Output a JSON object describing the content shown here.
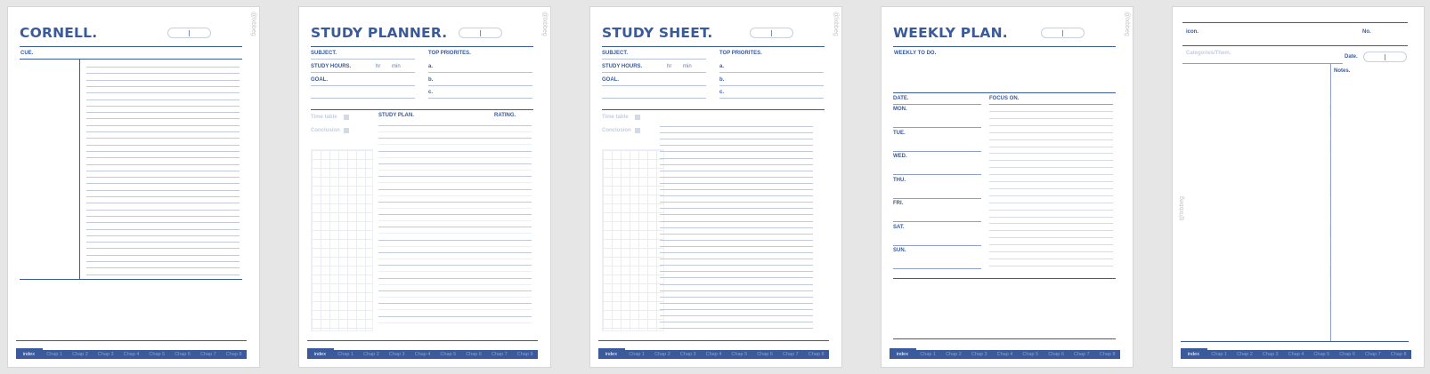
{
  "brand": "@lxbbeg",
  "tabs": [
    "index",
    "Chap 1",
    "Chap 2",
    "Chap 3",
    "Chap 4",
    "Chap 5",
    "Chap 6",
    "Chap 7",
    "Chap 8"
  ],
  "cornell": {
    "title": "CORNELL.",
    "cue_label": "CUE."
  },
  "planner": {
    "title": "STUDY PLANNER.",
    "subject": "SUBJECT.",
    "study_hours": "STUDY HOURS.",
    "hr": "hr",
    "min": "min",
    "goal": "GOAL.",
    "top_priorities": "TOP PRIORITES.",
    "prio_a": "a.",
    "prio_b": "b.",
    "prio_c": "c.",
    "time_table": "Time table",
    "conclusion": "Conclusion",
    "study_plan": "STUDY PLAN.",
    "rating": "RATING."
  },
  "sheet": {
    "title": "STUDY SHEET.",
    "subject": "SUBJECT.",
    "study_hours": "STUDY HOURS.",
    "hr": "hr",
    "min": "min",
    "goal": "GOAL.",
    "top_priorities": "TOP PRIORITES.",
    "prio_a": "a.",
    "prio_b": "b.",
    "prio_c": "c.",
    "time_table": "Time table",
    "conclusion": "Conclusion"
  },
  "weekly": {
    "title": "WEEKLY PLAN.",
    "todo": "WEEKLY TO DO.",
    "date": "DATE.",
    "focus_on": "FOCUS ON.",
    "days": [
      "MON.",
      "TUE.",
      "WED.",
      "THU.",
      "FRI.",
      "SAT.",
      "SUN."
    ]
  },
  "notes": {
    "icon": "icon.",
    "no": "No.",
    "categories_placeholder": "Categories/Them.",
    "date": "Date.",
    "notes": "Notes."
  }
}
